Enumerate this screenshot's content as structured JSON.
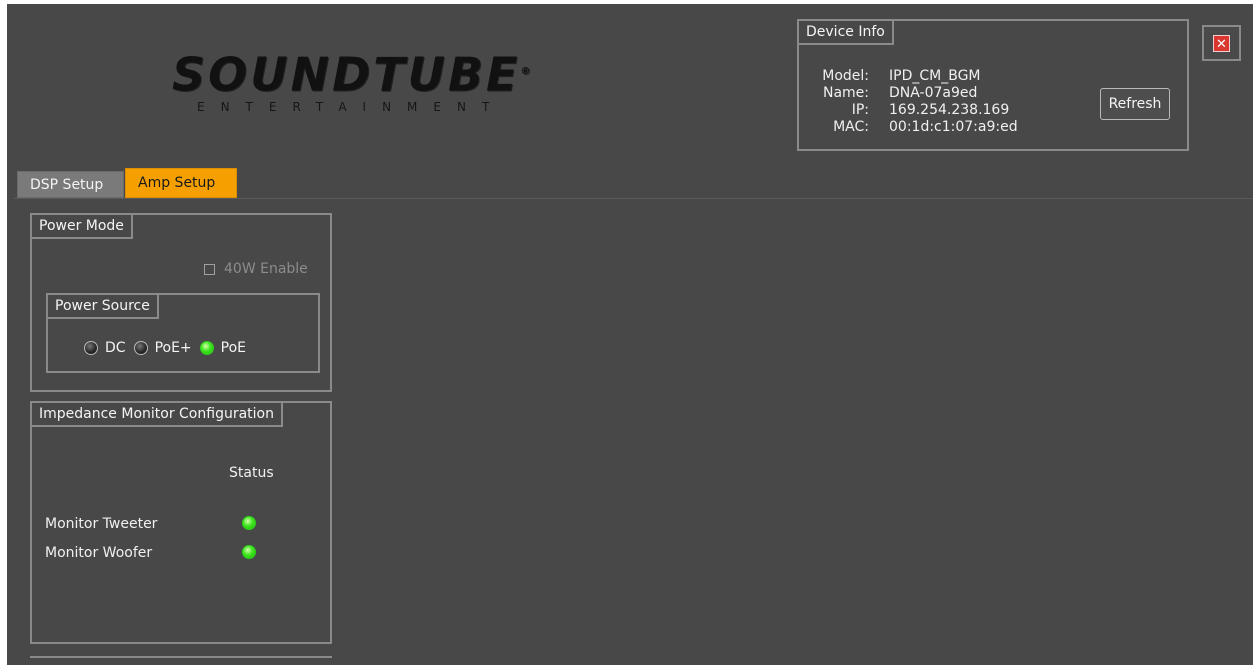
{
  "logo": {
    "main": "SOUNDTUBE",
    "registered": "®",
    "sub": "ENTERTAINMENT"
  },
  "device_info": {
    "title": "Device Info",
    "labels": [
      "Model:",
      "Name:",
      "IP:",
      "MAC:"
    ],
    "model": "IPD_CM_BGM",
    "name": "DNA-07a9ed",
    "ip": "169.254.238.169",
    "mac": "00:1d:c1:07:a9:ed",
    "refresh_label": "Refresh"
  },
  "close_button": {
    "icon": "close-icon",
    "glyph": "✕",
    "color": "#d9372f"
  },
  "tabs": [
    {
      "label": "DSP Setup",
      "active": false
    },
    {
      "label": "Amp Setup",
      "active": true
    }
  ],
  "power_mode": {
    "title": "Power Mode",
    "enable_40w": {
      "label": "40W Enable",
      "checked": false,
      "enabled": false
    },
    "power_source": {
      "title": "Power Source",
      "options": [
        {
          "label": "DC",
          "active": false
        },
        {
          "label": "PoE+",
          "active": false
        },
        {
          "label": "PoE",
          "active": true
        }
      ]
    }
  },
  "impedance": {
    "title": "Impedance Monitor Configuration",
    "status_header": "Status",
    "rows": [
      {
        "label": "Monitor Tweeter",
        "status": "ok"
      },
      {
        "label": "Monitor Woofer",
        "status": "ok"
      }
    ]
  },
  "colors": {
    "background": "#484848",
    "accent_tab": "#f5a000",
    "led_on": "#3ee61e",
    "led_off": "#2a2a2a",
    "border": "#8a8a8a"
  }
}
